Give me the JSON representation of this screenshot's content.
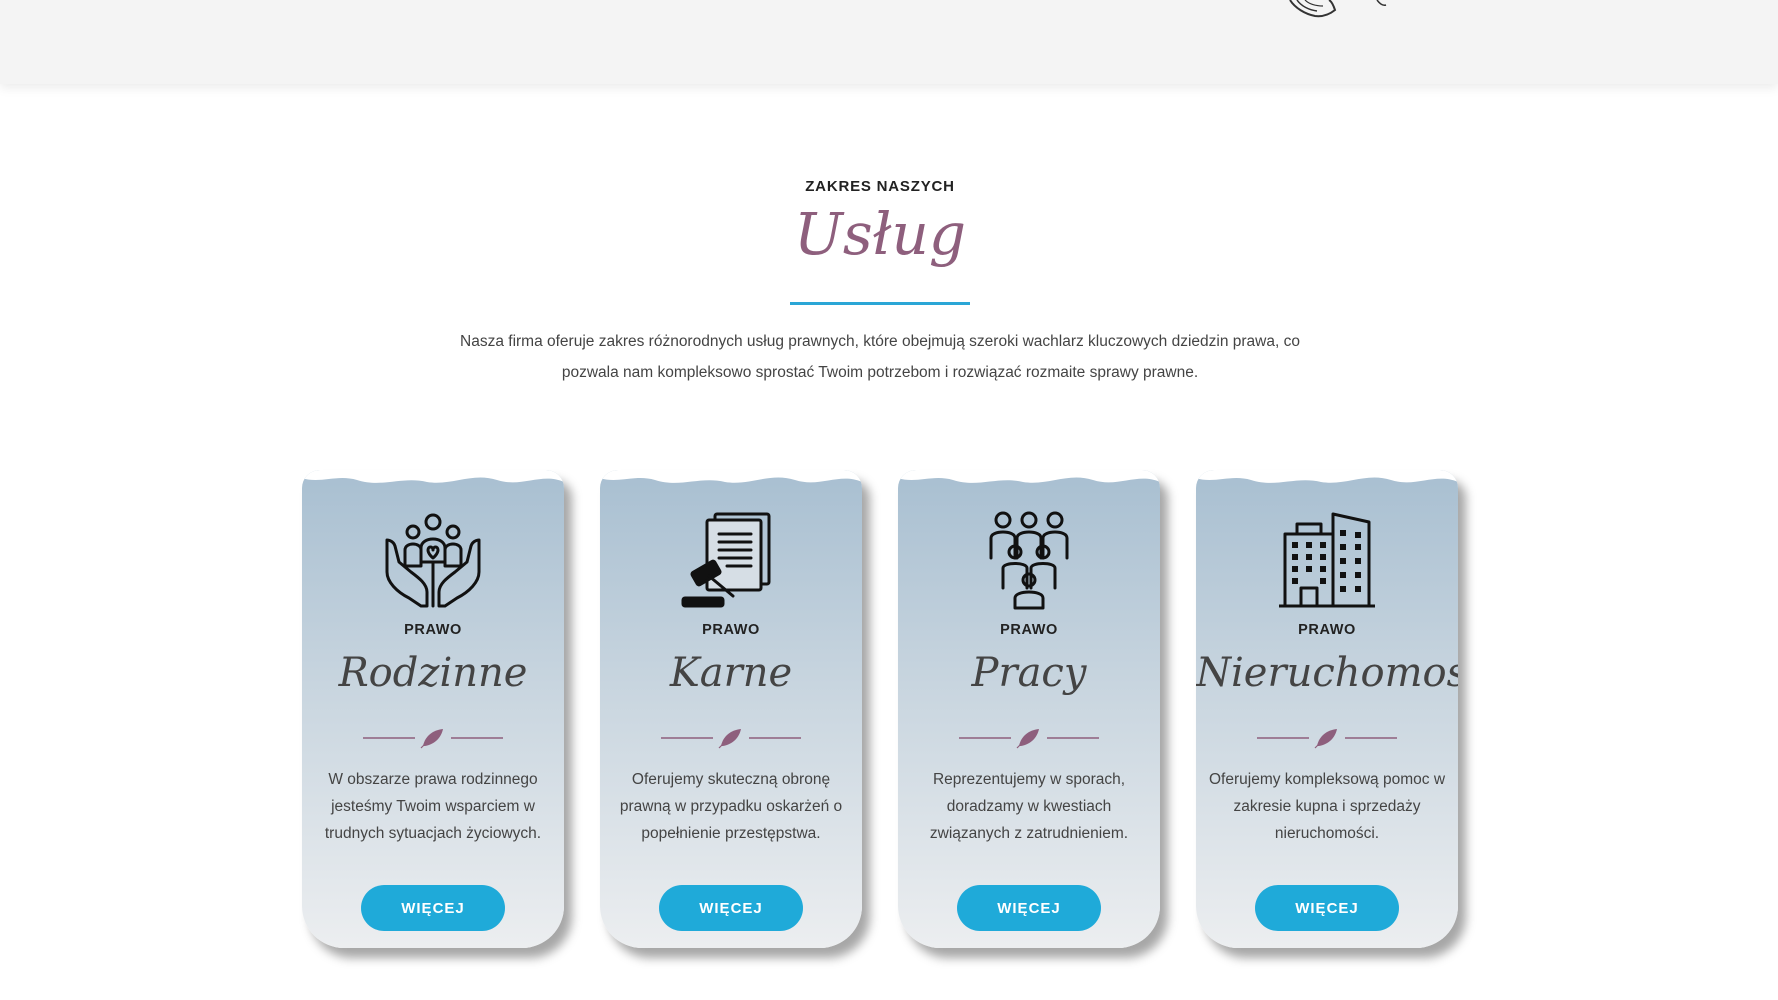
{
  "colors": {
    "accent_blue": "#1faad9",
    "script_purple": "#8e5f7d",
    "card_top": "#a8bfd1",
    "card_bottom": "#eceef0"
  },
  "header": {
    "decor_icon": "bird-sketch-icon"
  },
  "services": {
    "eyebrow": "ZAKRES NASZYCH",
    "title": "Usług",
    "intro_line1": "Nasza firma oferuje zakres różnorodnych usług prawnych, które obejmują szeroki wachlarz kluczowych dziedzin prawa, co",
    "intro_line2": "pozwala nam kompleksowo sprostać Twoim potrzebom i rozwiązać rozmaite sprawy prawne.",
    "cards": [
      {
        "icon": "family-hands-icon",
        "eyebrow": "PRAWO",
        "title": "Rodzinne",
        "desc_lines": [
          "W obszarze prawa rodzinnego",
          "jesteśmy Twoim wsparciem w",
          "trudnych sytuacjach życiowych."
        ],
        "button": "WIĘCEJ"
      },
      {
        "icon": "gavel-document-icon",
        "eyebrow": "PRAWO",
        "title": "Karne",
        "desc_lines": [
          "Oferujemy skuteczną obronę",
          "prawną w przypadku oskarżeń o",
          "popełnienie przestępstwa."
        ],
        "button": "WIĘCEJ"
      },
      {
        "icon": "workers-group-icon",
        "eyebrow": "PRAWO",
        "title": "Pracy",
        "desc_lines": [
          "Reprezentujemy w sporach,",
          "doradzamy w kwestiach",
          "związanych z zatrudnieniem."
        ],
        "button": "WIĘCEJ"
      },
      {
        "icon": "buildings-icon",
        "eyebrow": "PRAWO",
        "title": "Nieruchomości",
        "desc_lines": [
          "Oferujemy kompleksową pomoc w",
          "zakresie kupna i sprzedaży",
          "nieruchomości."
        ],
        "button": "WIĘCEJ"
      }
    ]
  }
}
